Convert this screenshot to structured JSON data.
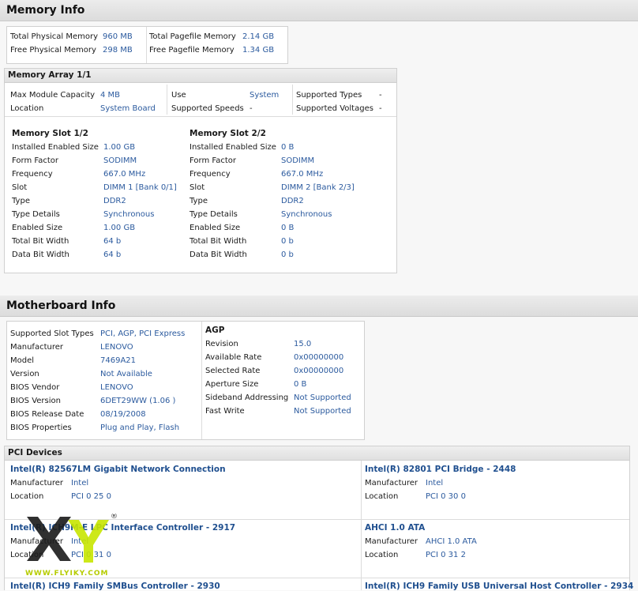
{
  "memory_info": {
    "title": "Memory Info",
    "summary": [
      {
        "label": "Total Physical Memory",
        "value": "960 MB"
      },
      {
        "label": "Free Physical Memory",
        "value": "298 MB"
      },
      {
        "label": "Total Pagefile Memory",
        "value": "2.14 GB"
      },
      {
        "label": "Free Pagefile Memory",
        "value": "1.34 GB"
      }
    ],
    "array": {
      "title": "Memory Array 1/1",
      "fields": [
        {
          "label": "Max Module Capacity",
          "value": "4 MB"
        },
        {
          "label": "Location",
          "value": "System Board"
        },
        {
          "label": "Use",
          "value": "System"
        },
        {
          "label": "Supported Speeds",
          "value": "-"
        },
        {
          "label": "Supported Types",
          "value": "-"
        },
        {
          "label": "Supported Voltages",
          "value": "-"
        }
      ],
      "slots": [
        {
          "title": "Memory Slot 1/2",
          "rows": [
            {
              "label": "Installed Enabled Size",
              "value": "1.00 GB"
            },
            {
              "label": "Form Factor",
              "value": "SODIMM"
            },
            {
              "label": "Frequency",
              "value": "667.0 MHz"
            },
            {
              "label": "Slot",
              "value": "DIMM 1 [Bank 0/1]"
            },
            {
              "label": "Type",
              "value": "DDR2"
            },
            {
              "label": "Type Details",
              "value": "Synchronous"
            },
            {
              "label": "Enabled Size",
              "value": "1.00 GB"
            },
            {
              "label": "Total Bit Width",
              "value": "64 b"
            },
            {
              "label": "Data Bit Width",
              "value": "64 b"
            }
          ]
        },
        {
          "title": "Memory Slot 2/2",
          "rows": [
            {
              "label": "Installed Enabled Size",
              "value": "0 B"
            },
            {
              "label": "Form Factor",
              "value": "SODIMM"
            },
            {
              "label": "Frequency",
              "value": "667.0 MHz"
            },
            {
              "label": "Slot",
              "value": "DIMM 2 [Bank 2/3]"
            },
            {
              "label": "Type",
              "value": "DDR2"
            },
            {
              "label": "Type Details",
              "value": "Synchronous"
            },
            {
              "label": "Enabled Size",
              "value": "0 B"
            },
            {
              "label": "Total Bit Width",
              "value": "0 b"
            },
            {
              "label": "Data Bit Width",
              "value": "0 b"
            }
          ]
        }
      ]
    }
  },
  "motherboard_info": {
    "title": "Motherboard Info",
    "rows": [
      {
        "label": "Supported Slot Types",
        "value": "PCI, AGP, PCI Express"
      },
      {
        "label": "Manufacturer",
        "value": "LENOVO"
      },
      {
        "label": "Model",
        "value": "7469A21"
      },
      {
        "label": "Version",
        "value": "Not Available"
      },
      {
        "label": "BIOS Vendor",
        "value": "LENOVO"
      },
      {
        "label": "BIOS Version",
        "value": "6DET29WW (1.06 )"
      },
      {
        "label": "BIOS Release Date",
        "value": "08/19/2008"
      },
      {
        "label": "BIOS Properties",
        "value": "Plug and Play, Flash"
      }
    ],
    "agp": {
      "title": "AGP",
      "rows": [
        {
          "label": "Revision",
          "value": "15.0"
        },
        {
          "label": "Available Rate",
          "value": "0x00000000"
        },
        {
          "label": "Selected Rate",
          "value": "0x00000000"
        },
        {
          "label": "Aperture Size",
          "value": "0 B"
        },
        {
          "label": "Sideband Addressing",
          "value": "Not Supported"
        },
        {
          "label": "Fast Write",
          "value": "Not Supported"
        }
      ]
    },
    "pci": {
      "title": "PCI Devices",
      "devices": [
        {
          "name": "Intel(R) 82567LM Gigabit Network Connection",
          "manufacturer": "Intel",
          "location": "PCI 0 25 0"
        },
        {
          "name": "Intel(R) 82801 PCI Bridge - 2448",
          "manufacturer": "Intel",
          "location": "PCI 0 30 0"
        },
        {
          "name": "Intel(R) ICH9M-E LPC Interface Controller - 2917",
          "manufacturer": "Intel",
          "location": "PCI 0 31 0"
        },
        {
          "name": "AHCI 1.0 ATA",
          "manufacturer": "AHCI 1.0 ATA",
          "location": "PCI 0 31 2"
        },
        {
          "name": "Intel(R) ICH9 Family SMBus Controller - 2930",
          "manufacturer": "",
          "location": ""
        },
        {
          "name": "Intel(R) ICH9 Family USB Universal Host Controller - 2934",
          "manufacturer": "",
          "location": ""
        }
      ],
      "manufacturer_label": "Manufacturer",
      "location_label": "Location"
    }
  },
  "watermark": {
    "text": "WWW.FLYIKY.COM",
    "registered": "®"
  }
}
